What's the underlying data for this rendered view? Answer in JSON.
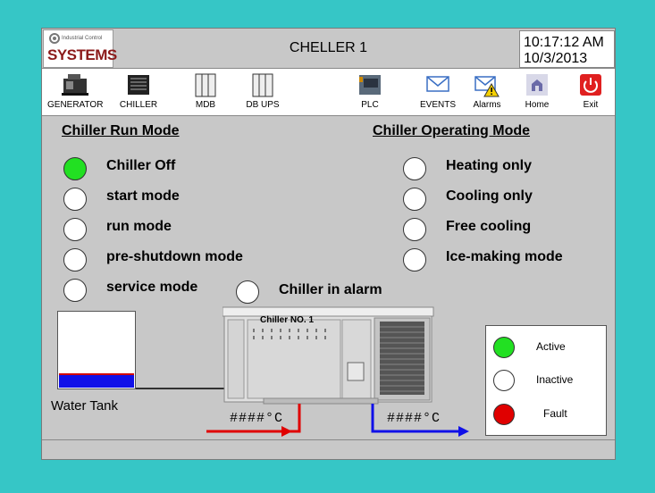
{
  "header": {
    "logo_small": "Industrial Control",
    "logo_big": "SYSTEMS",
    "title": "CHELLER 1",
    "time": "10:17:12 AM",
    "date": "10/3/2013"
  },
  "toolbar": {
    "items": [
      {
        "label": "GENERATOR",
        "icon": "generator-icon"
      },
      {
        "label": "CHILLER",
        "icon": "chiller-icon"
      },
      {
        "label": "MDB",
        "icon": "cabinet-icon"
      },
      {
        "label": "DB UPS",
        "icon": "cabinet-icon"
      },
      {
        "label": "PLC",
        "icon": "plc-icon"
      },
      {
        "label": "EVENTS",
        "icon": "envelope-icon"
      },
      {
        "label": "Alarms",
        "icon": "alarm-icon"
      },
      {
        "label": "Home",
        "icon": "home-icon"
      },
      {
        "label": "Exit",
        "icon": "power-icon"
      }
    ]
  },
  "run_mode": {
    "heading": "Chiller Run Mode",
    "items": [
      {
        "label": "Chiller Off",
        "state": "active"
      },
      {
        "label": "start mode",
        "state": "inactive"
      },
      {
        "label": "run mode",
        "state": "inactive"
      },
      {
        "label": "pre-shutdown mode",
        "state": "inactive"
      },
      {
        "label": "service mode",
        "state": "inactive"
      }
    ]
  },
  "operating_mode": {
    "heading": "Chiller Operating Mode",
    "items": [
      {
        "label": "Heating only",
        "state": "inactive"
      },
      {
        "label": "Cooling only",
        "state": "inactive"
      },
      {
        "label": "Free cooling",
        "state": "inactive"
      },
      {
        "label": "Ice-making mode",
        "state": "inactive"
      }
    ]
  },
  "alarm": {
    "label": "Chiller in alarm",
    "state": "inactive"
  },
  "tank": {
    "label": "Water Tank",
    "level_fraction": 0.2
  },
  "chiller_unit": {
    "label": "Chiller NO. 1"
  },
  "temperatures": {
    "supply": "####°C",
    "return": "####°C"
  },
  "legend": {
    "active": "Active",
    "inactive": "Inactive",
    "fault": "Fault"
  },
  "colors": {
    "background": "#36c6c6",
    "panel": "#c8c8c8",
    "active": "#22e022",
    "inactive": "#ffffff",
    "fault": "#e00000",
    "hot_pipe": "#e00000",
    "cold_pipe": "#1010e8"
  }
}
